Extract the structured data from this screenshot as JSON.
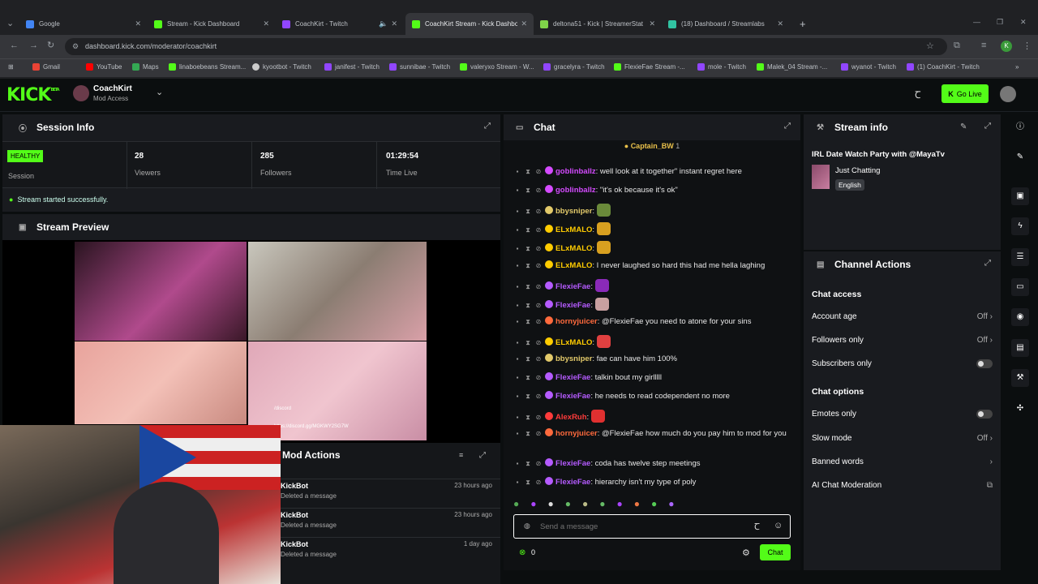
{
  "browser": {
    "tabs": [
      {
        "label": "Google",
        "color": "#4285f4"
      },
      {
        "label": "Stream - Kick Dashboard",
        "color": "#53fc18"
      },
      {
        "label": "CoachKirt - Twitch",
        "color": "#9146ff"
      },
      {
        "label": "CoachKirt Stream - Kick Dashbo",
        "color": "#53fc18"
      },
      {
        "label": "deltona51 - Kick | StreamerStat",
        "color": "#7fd349"
      },
      {
        "label": "(18) Dashboard / Streamlabs",
        "color": "#31c3a2"
      }
    ],
    "url": "dashboard.kick.com/moderator/coachkirt",
    "bookmarks": [
      "Gmail",
      "YouTube",
      "Maps",
      "linaboebeans Stream...",
      "kyootbot - Twitch",
      "janifest - Twitch",
      "sunnibae - Twitch",
      "valeryxo Stream - W...",
      "gracelyra - Twitch",
      "FlexieFae Stream -...",
      "mole - Twitch",
      "Malek_04 Stream -...",
      "wyanot - Twitch",
      "(1) CoachKirt - Twitch"
    ]
  },
  "header": {
    "logo": "KICK",
    "beta": "BETA",
    "channel": "CoachKirt",
    "role": "Mod Access",
    "go_live": "Go Live"
  },
  "session": {
    "title": "Session Info",
    "health": "HEALTHY",
    "health_label": "Session",
    "viewers": "28",
    "viewers_label": "Viewers",
    "followers": "285",
    "followers_label": "Followers",
    "time_live": "01:29:54",
    "time_live_label": "Time Live",
    "status": "Stream started successfully."
  },
  "preview": {
    "title": "Stream Preview"
  },
  "mod_actions": {
    "title": "Mod Actions",
    "items": [
      {
        "user": "KickBot",
        "action": "Deleted a message",
        "time": "23 hours ago"
      },
      {
        "user": "KickBot",
        "action": "Deleted a message",
        "time": "23 hours ago"
      },
      {
        "user": "KickBot",
        "action": "Deleted a message",
        "time": "1 day ago"
      }
    ]
  },
  "chat": {
    "title": "Chat",
    "pinned": "Captain_BW",
    "pinned_count": "1",
    "messages": [
      {
        "user": "goblinballz",
        "color": "#d44bff",
        "text": "well look at it together\" instant regret here"
      },
      {
        "user": "goblinballz",
        "color": "#d44bff",
        "text": "\"it's ok because it's ok\""
      },
      {
        "user": "bbysniper",
        "color": "#e2c96a",
        "text": ""
      },
      {
        "user": "ELxMALO",
        "color": "#ffcc00",
        "text": ""
      },
      {
        "user": "ELxMALO",
        "color": "#ffcc00",
        "text": ""
      },
      {
        "user": "ELxMALO",
        "color": "#ffcc00",
        "text": "I never laughed so hard this had me hella laghing"
      },
      {
        "user": "FlexieFae",
        "color": "#b55bff",
        "text": ""
      },
      {
        "user": "FlexieFae",
        "color": "#b55bff",
        "text": ""
      },
      {
        "user": "hornyjuicer",
        "color": "#ff6a3d",
        "text": "@FlexieFae you need to atone for your sins"
      },
      {
        "user": "ELxMALO",
        "color": "#ffcc00",
        "text": ""
      },
      {
        "user": "bbysniper",
        "color": "#e2c96a",
        "text": "fae can have him 100%"
      },
      {
        "user": "FlexieFae",
        "color": "#b55bff",
        "text": "talkin bout my girlllll"
      },
      {
        "user": "FlexieFae",
        "color": "#b55bff",
        "text": "he needs to read codependent no more"
      },
      {
        "user": "AlexRuh",
        "color": "#ff3b3b",
        "text": ""
      },
      {
        "user": "hornyjuicer",
        "color": "#ff6a3d",
        "text": "@FlexieFae how much do you pay him to mod for you"
      },
      {
        "user": "FlexieFae",
        "color": "#b55bff",
        "text": "coda has twelve step meetings"
      },
      {
        "user": "FlexieFae",
        "color": "#b55bff",
        "text": "hierarchy isn't my type of poly"
      }
    ],
    "placeholder": "Send a message",
    "count": "0",
    "send": "Chat"
  },
  "stream_info": {
    "title": "Stream info",
    "stream_title": "IRL Date Watch Party with @MayaTv",
    "category": "Just Chatting",
    "language": "English"
  },
  "channel_actions": {
    "title": "Channel Actions",
    "chat_access": "Chat access",
    "account_age": "Account age",
    "account_age_val": "Off",
    "followers_only": "Followers only",
    "followers_only_val": "Off",
    "subscribers_only": "Subscribers only",
    "chat_options": "Chat options",
    "emotes_only": "Emotes only",
    "slow_mode": "Slow mode",
    "slow_mode_val": "Off",
    "banned_words": "Banned words",
    "ai_moderation": "AI Chat Moderation"
  },
  "overlay": {
    "discord": "/discord",
    "discord_url": "https://discord.gg/MGKWY2SG7W"
  }
}
